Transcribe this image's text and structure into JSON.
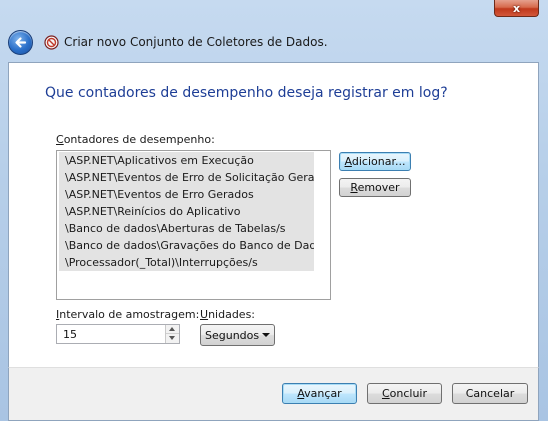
{
  "window": {
    "title": "Criar novo Conjunto de Coletores de Dados.",
    "close_glyph": "x",
    "back_icon": "back-arrow-icon",
    "app_icon": "performance-monitor-icon"
  },
  "page": {
    "heading": "Que contadores de desempenho deseja registrar em log?"
  },
  "counters": {
    "label_first": "C",
    "label_rest": "ontadores de desempenho:",
    "items": [
      "\\ASP.NET\\Aplicativos em Execução",
      "\\ASP.NET\\Eventos de Erro de Solicitação Gerad...",
      "\\ASP.NET\\Eventos de Erro Gerados",
      "\\ASP.NET\\Reinícios do Aplicativo",
      "\\Banco de dados\\Aberturas de Tabelas/s",
      "\\Banco de dados\\Gravações do Banco de Dad...",
      "\\Processador(_Total)\\Interrupções/s"
    ],
    "add_first": "A",
    "add_rest": "dicionar...",
    "remove_first": "R",
    "remove_rest": "emover"
  },
  "sampling": {
    "interval_label_first": "I",
    "interval_label_rest": "ntervalo de amostragem:",
    "interval_value": "15",
    "units_label_first": "U",
    "units_label_rest": "nidades:",
    "units_value": "Segundos"
  },
  "footer": {
    "next_first": "A",
    "next_rest": "vançar",
    "finish_first": "C",
    "finish_rest": "oncluir",
    "cancel_label": "Cancelar"
  },
  "colors": {
    "heading": "#1e3e96",
    "list_selection": "#e3e3e3",
    "default_button_border": "#3c7fb1"
  }
}
